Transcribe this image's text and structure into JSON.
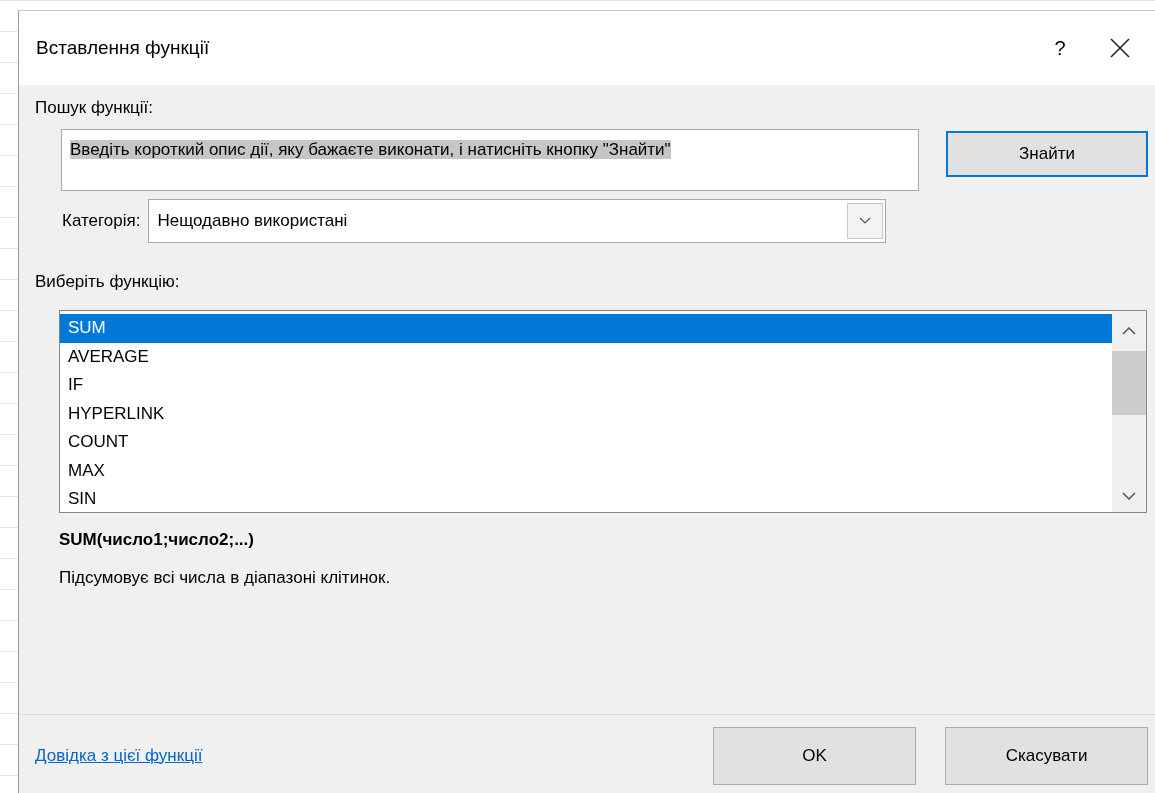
{
  "window": {
    "title": "Вставлення функції",
    "help_button": "?"
  },
  "search": {
    "label": "Пошук функції:",
    "value": "Введіть короткий опис дії, яку бажаєте виконати, і натисніть кнопку \"Знайти\"",
    "highlighted": true,
    "button": "Знайти"
  },
  "category": {
    "label": "Категорія:",
    "value": "Нещодавно використані"
  },
  "function_list": {
    "label": "Виберіть функцію:",
    "items": [
      {
        "name": "SUM",
        "selected": true
      },
      {
        "name": "AVERAGE",
        "selected": false
      },
      {
        "name": "IF",
        "selected": false
      },
      {
        "name": "HYPERLINK",
        "selected": false
      },
      {
        "name": "COUNT",
        "selected": false
      },
      {
        "name": "MAX",
        "selected": false
      },
      {
        "name": "SIN",
        "selected": false
      }
    ]
  },
  "signature": "SUM(число1;число2;...)",
  "description": "Підсумовує всі числа в діапазоні клітинок.",
  "help_link": "Довідка з цієї функції",
  "buttons": [
    "OK",
    "Скасувати"
  ]
}
